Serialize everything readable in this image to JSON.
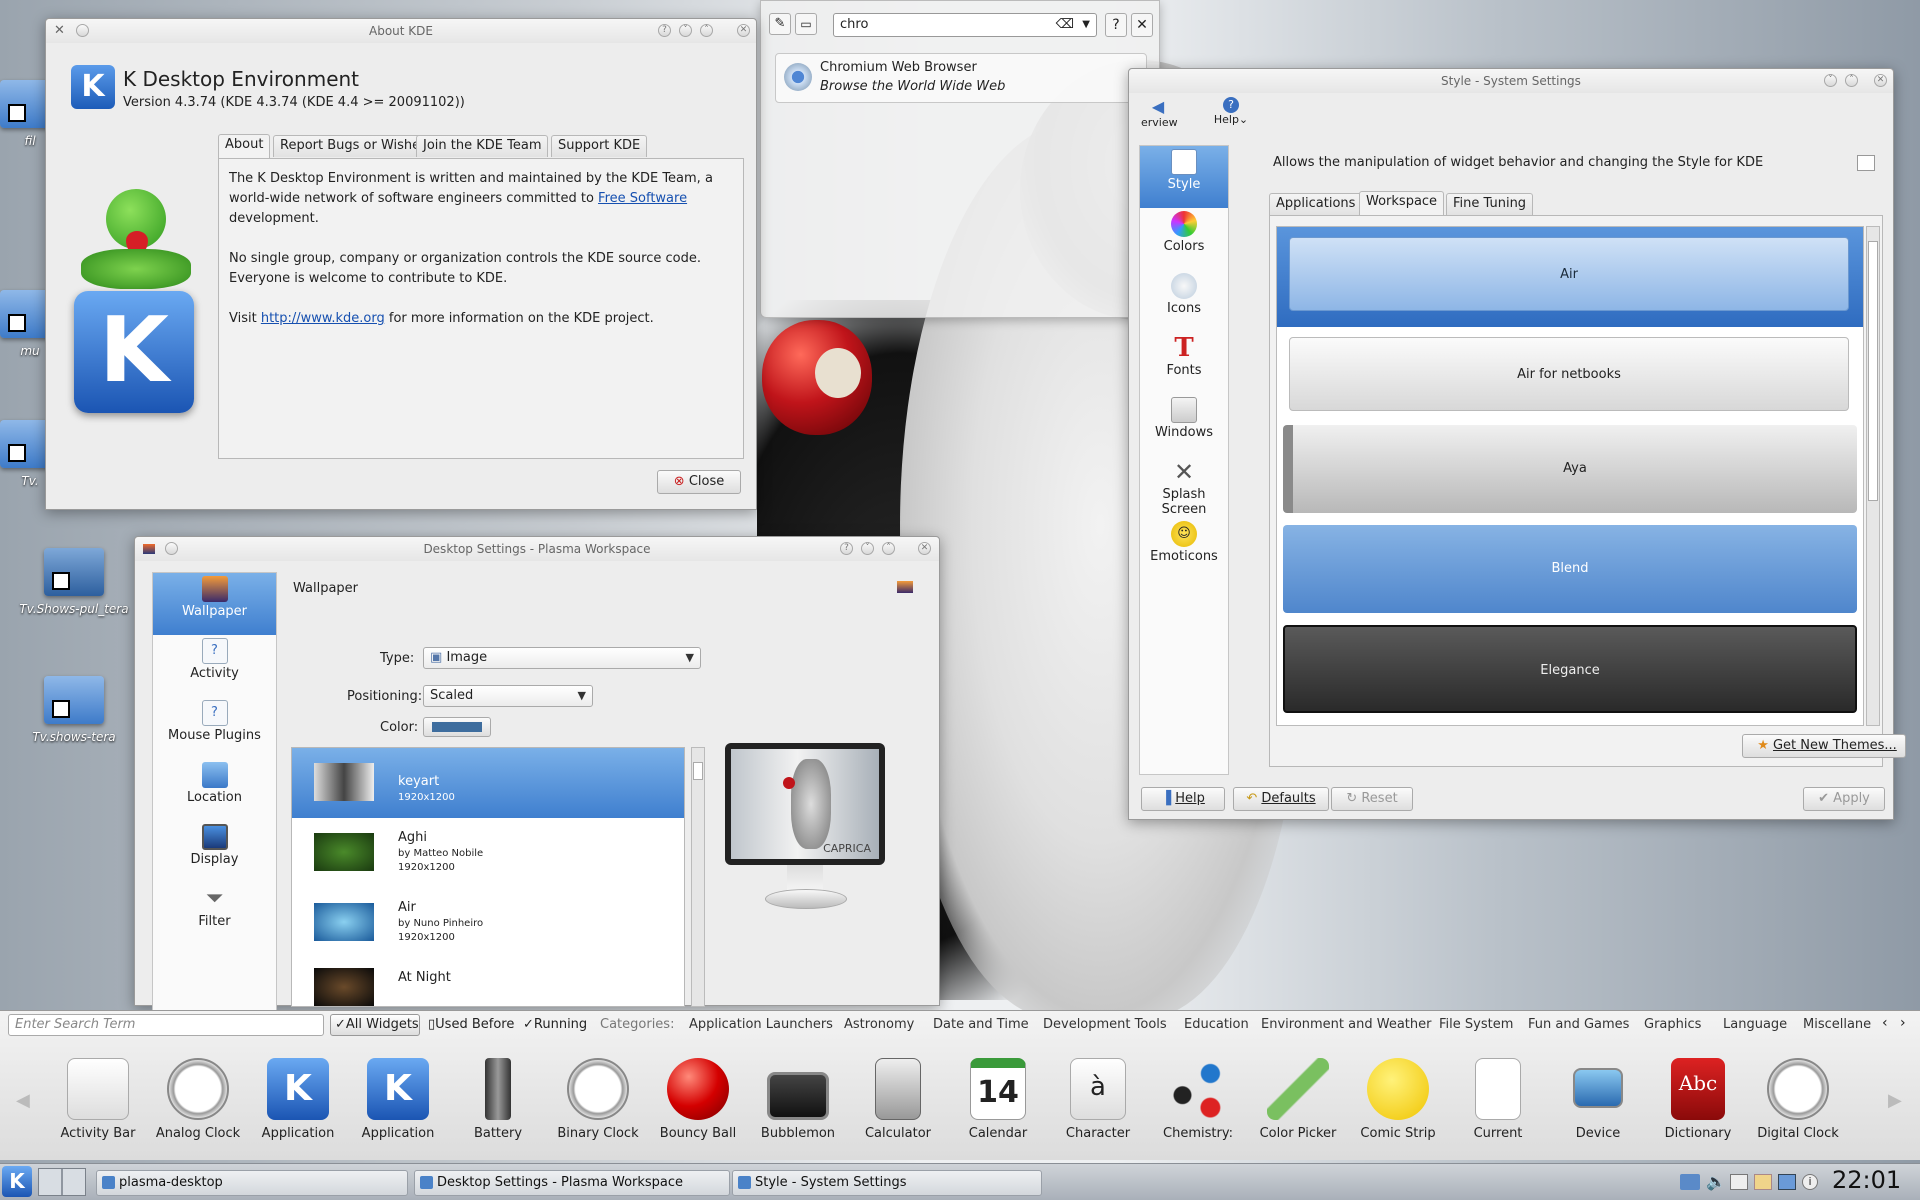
{
  "desktop": {
    "icons": [
      {
        "label": "fil"
      },
      {
        "label": "mu"
      },
      {
        "label": "Tv."
      },
      {
        "label": "Tv.Shows-pul_tera"
      },
      {
        "label": "Tv.shows-tera"
      }
    ]
  },
  "about_kde": {
    "title": "About KDE",
    "heading": "K Desktop Environment",
    "version": "Version 4.3.74 (KDE 4.3.74 (KDE 4.4 >= 20091102))",
    "tabs": [
      "About",
      "Report Bugs or Wishes",
      "Join the KDE Team",
      "Support KDE"
    ],
    "para1_a": "The K Desktop Environment is written and maintained by the KDE Team, a world-wide network of software engineers committed to ",
    "para1_link": "Free Software",
    "para1_b": " development.",
    "para2": "No single group, company or organization controls the KDE source code. Everyone is welcome to contribute to KDE.",
    "para3_a": "Visit ",
    "para3_link": "http://www.kde.org",
    "para3_b": " for more information on the KDE project.",
    "close_label": "Close"
  },
  "krunner": {
    "query": "chro",
    "help": "?",
    "result_title": "Chromium Web Browser",
    "result_subtitle": "Browse the World Wide Web"
  },
  "system_settings": {
    "title": "Style - System Settings",
    "toolbar": [
      "Overview",
      "Help"
    ],
    "toolbar_visible": [
      "erview",
      "Help"
    ],
    "sidebar": [
      "Style",
      "Colors",
      "Icons",
      "Fonts",
      "Windows",
      "Splash Screen",
      "Emoticons"
    ],
    "description": "Allows the manipulation of widget behavior and changing the Style for KDE",
    "tabs": [
      "Applications",
      "Workspace",
      "Fine Tuning"
    ],
    "themes": [
      "Air",
      "Air for netbooks",
      "Aya",
      "Blend",
      "Elegance"
    ],
    "get_new": "Get New Themes...",
    "buttons": {
      "help": "Help",
      "defaults": "Defaults",
      "reset": "Reset",
      "apply": "Apply"
    }
  },
  "desktop_settings": {
    "title": "Desktop Settings - Plasma Workspace",
    "sidebar": [
      "Wallpaper",
      "Activity",
      "Mouse Plugins",
      "Location",
      "Display",
      "Filter"
    ],
    "section": "Wallpaper",
    "type_label": "Type:",
    "type_value": "Image",
    "positioning_label": "Positioning:",
    "positioning_value": "Scaled",
    "color_label": "Color:",
    "wallpapers": [
      {
        "name": "keyart",
        "author": "",
        "size": "1920x1200"
      },
      {
        "name": "Aghi",
        "author": "by Matteo Nobile",
        "size": "1920x1200"
      },
      {
        "name": "Air",
        "author": "by Nuno Pinheiro",
        "size": "1920x1200"
      },
      {
        "name": "At Night",
        "author": "",
        "size": ""
      }
    ],
    "preview_caption": "CAPRICA"
  },
  "widget_explorer": {
    "search_placeholder": "Enter Search Term",
    "filters": [
      "All Widgets",
      "Used Before",
      "Running"
    ],
    "categories_label": "Categories:",
    "categories": [
      "Application Launchers",
      "Astronomy",
      "Date and Time",
      "Development Tools",
      "Education",
      "Environment and Weather",
      "File System",
      "Fun and Games",
      "Graphics",
      "Language",
      "Miscellane"
    ],
    "widgets": [
      "Activity Bar",
      "Analog Clock",
      "Application",
      "Application",
      "Battery",
      "Binary Clock",
      "Bouncy Ball",
      "Bubblemon",
      "Calculator",
      "Calendar",
      "Character",
      "Chemistry:",
      "Color Picker",
      "Comic Strip",
      "Current",
      "Device",
      "Dictionary",
      "Digital Clock"
    ],
    "calendar_day": "14",
    "character_glyph": "à",
    "dictionary_glyph": "Abc"
  },
  "taskbar": {
    "tasks": [
      "plasma-desktop",
      "Desktop Settings - Plasma Workspace",
      "Style - System Settings"
    ],
    "clock": "22:01"
  }
}
